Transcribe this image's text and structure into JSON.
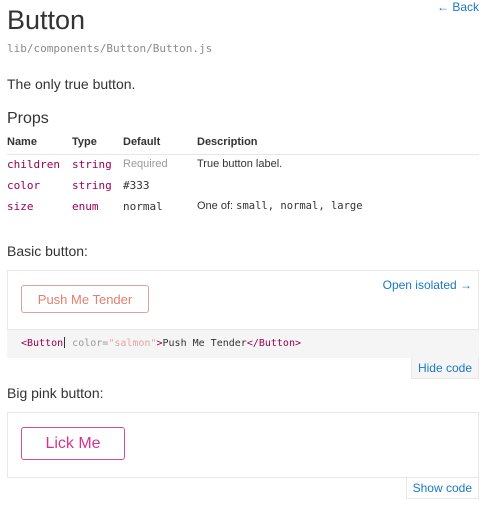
{
  "header": {
    "title": "Button",
    "back_link": "← Back",
    "path": "lib/components/Button/Button.js",
    "description": "The only true button."
  },
  "props_section": {
    "heading": "Props",
    "columns": [
      "Name",
      "Type",
      "Default",
      "Description"
    ],
    "rows": [
      {
        "name": "children",
        "type": "string",
        "default": "Required",
        "description": "True button label."
      },
      {
        "name": "color",
        "type": "string",
        "default": "#333",
        "description": ""
      },
      {
        "name": "size",
        "type": "enum",
        "default": "normal",
        "description_prefix": "One of: ",
        "description_code": "small, normal, large"
      }
    ]
  },
  "basic_example": {
    "heading": "Basic button:",
    "button_label": "Push Me Tender",
    "open_isolated": "Open isolated →",
    "code": {
      "tag_open": "<Button",
      "attr_name": " color=",
      "attr_value": "\"salmon\"",
      "tag_close": ">",
      "text": "Push Me Tender",
      "end_tag": "</Button>"
    },
    "toggle_label": "Hide code"
  },
  "big_example": {
    "heading": "Big pink button:",
    "button_label": "Lick Me",
    "toggle_label": "Show code"
  },
  "colors": {
    "link": "#1978c8",
    "salmon": "#e08070",
    "pink": "#d8338c",
    "code_tag": "#905"
  }
}
